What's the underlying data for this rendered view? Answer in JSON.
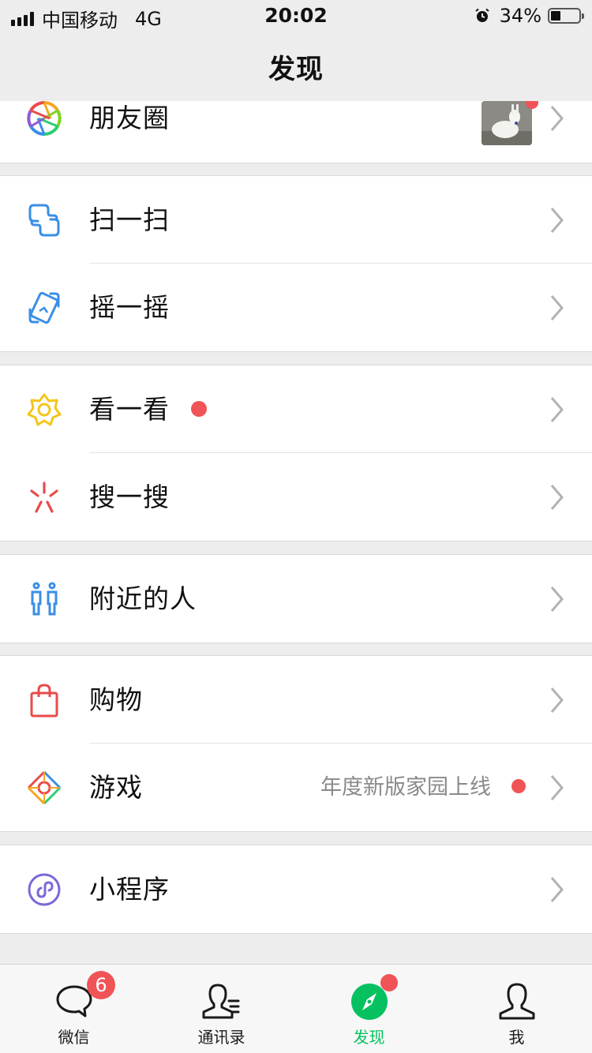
{
  "status_bar": {
    "carrier": "中国移动",
    "network": "4G",
    "time": "20:02",
    "battery_percent": "34%",
    "battery_level": 0.34
  },
  "nav": {
    "title": "发现"
  },
  "menu": {
    "moments": {
      "label": "朋友圈",
      "has_new_dot": true
    },
    "scan": {
      "label": "扫一扫"
    },
    "shake": {
      "label": "摇一摇"
    },
    "top_stories": {
      "label": "看一看",
      "has_new_dot": true
    },
    "search": {
      "label": "搜一搜"
    },
    "nearby": {
      "label": "附近的人"
    },
    "shopping": {
      "label": "购物"
    },
    "games": {
      "label": "游戏",
      "subtitle": "年度新版家园上线",
      "has_new_dot": true
    },
    "mini_programs": {
      "label": "小程序"
    }
  },
  "tabbar": {
    "chats": {
      "label": "微信",
      "badge": "6"
    },
    "contacts": {
      "label": "通讯录"
    },
    "discover": {
      "label": "发现",
      "has_new_dot": true,
      "active": true
    },
    "me": {
      "label": "我"
    }
  },
  "colors": {
    "accent_green": "#07c160",
    "badge_red": "#f05456",
    "background": "#ededed"
  }
}
